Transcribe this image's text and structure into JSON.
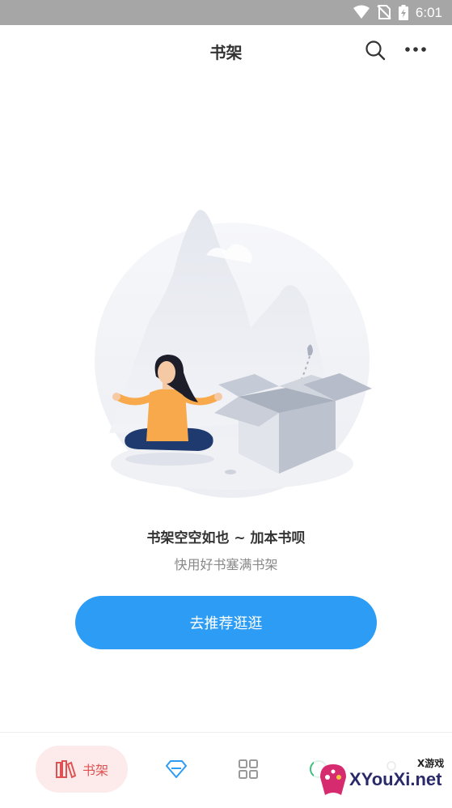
{
  "status_bar": {
    "time": "6:01"
  },
  "header": {
    "title": "书架"
  },
  "empty_state": {
    "title": "书架空空如也 ~ 加本书呗",
    "subtitle": "快用好书塞满书架",
    "button_label": "去推荐逛逛"
  },
  "bottom_nav": {
    "items": [
      {
        "label": "书架",
        "icon": "bookshelf-icon",
        "active": true
      },
      {
        "label": "",
        "icon": "diamond-icon",
        "active": false
      },
      {
        "label": "",
        "icon": "grid-icon",
        "active": false
      },
      {
        "label": "",
        "icon": "circle-icon",
        "active": false
      },
      {
        "label": "",
        "icon": "user-icon",
        "active": false
      }
    ]
  },
  "watermark": {
    "text": "XYouXi.net",
    "small": "X游戏"
  },
  "colors": {
    "accent": "#2d9cf5",
    "active_tab_bg": "#fdeaea",
    "active_tab_text": "#e05252",
    "status_bar": "#a6a6a6"
  }
}
